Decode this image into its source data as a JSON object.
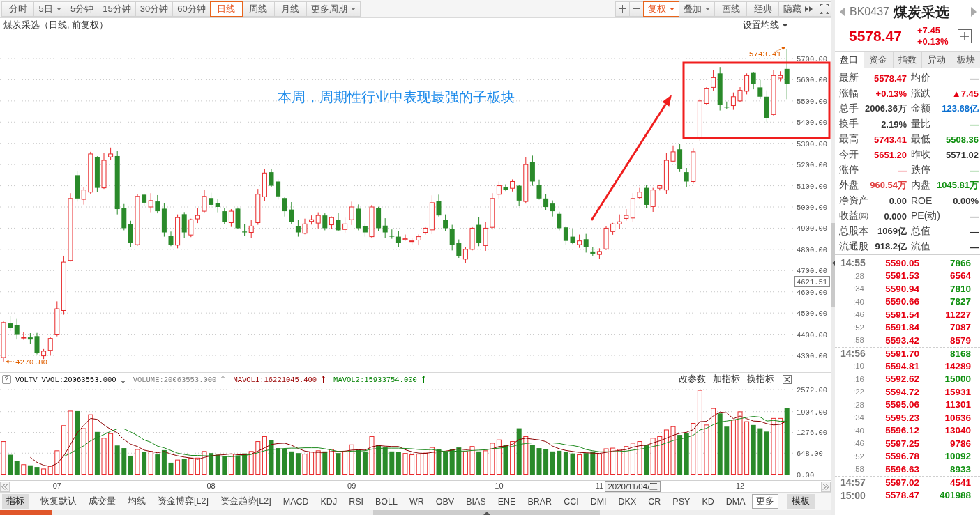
{
  "toolbar": {
    "periods": [
      {
        "label": "分时",
        "selected": false,
        "kind": "plain"
      },
      {
        "label": "5日",
        "selected": false,
        "kind": "dropdown"
      },
      {
        "label": "5分钟",
        "selected": false,
        "kind": "plain"
      },
      {
        "label": "15分钟",
        "selected": false,
        "kind": "plain"
      },
      {
        "label": "30分钟",
        "selected": false,
        "kind": "plain"
      },
      {
        "label": "60分钟",
        "selected": false,
        "kind": "plain"
      },
      {
        "label": "日线",
        "selected": true,
        "kind": "plain"
      },
      {
        "label": "周线",
        "selected": false,
        "kind": "plain"
      },
      {
        "label": "月线",
        "selected": false,
        "kind": "plain"
      },
      {
        "label": "更多周期",
        "selected": false,
        "kind": "dropdown"
      }
    ],
    "tools": [
      {
        "label": "复权",
        "selected": true,
        "kind": "dropdown"
      },
      {
        "label": "叠加",
        "selected": false,
        "kind": "dropdown"
      },
      {
        "label": "画线",
        "selected": false,
        "kind": "plain"
      },
      {
        "label": "经典",
        "selected": false,
        "kind": "plain"
      },
      {
        "label": "隐藏",
        "selected": false,
        "kind": "expand"
      }
    ]
  },
  "chart_header": {
    "title": "煤炭采选（日线, 前复权）",
    "ma_settings": "设置均线"
  },
  "price_chart": {
    "annotation": "本周，周期性行业中表现最强的子板块",
    "high_label": "5743.41",
    "low_label": "4270.80",
    "cursor_price": "4621.51",
    "axis_labels": [
      "5700.00",
      "5600.00",
      "5500.00",
      "5400.00",
      "5300.00",
      "5200.00",
      "5100.00",
      "5000.00",
      "4900.00",
      "4800.00",
      "4700.00",
      "4600.00",
      "4500.00",
      "4400.00",
      "4300.00"
    ]
  },
  "volume_panel": {
    "help": "?",
    "name": "VOLTV",
    "indicators": [
      {
        "text": "VVOL:20063553.000",
        "color": "#000000",
        "rising": false
      },
      {
        "text": "VOLUME:20063553.000",
        "color": "#808080",
        "rising": true
      },
      {
        "text": "MAVOL1:16221045.400",
        "color": "#990000",
        "rising": true
      },
      {
        "text": "MAVOL2:15933754.000",
        "color": "#008000",
        "rising": true
      }
    ],
    "actions": [
      "改参数",
      "加指标",
      "换指标"
    ],
    "chart_data": {
      "type": "bar",
      "ylim": [
        0,
        2572
      ],
      "grid": true,
      "yticks": [
        {
          "value": 0,
          "label": "0.00"
        },
        {
          "value": 648,
          "label": "648.00"
        },
        {
          "value": 1276,
          "label": "1276.00"
        },
        {
          "value": 1904,
          "label": "1904.00"
        },
        {
          "value": 2572,
          "label": "2572.00"
        }
      ],
      "series": [
        {
          "values": [
            1000,
            600,
            420,
            300,
            280,
            230,
            170,
            250,
            720,
            1480,
            1920,
            1920,
            1390,
            1810,
            1290,
            1100,
            1240,
            880,
            800,
            570,
            760,
            680,
            700,
            610,
            740,
            360,
            440,
            480,
            500,
            500,
            700,
            650,
            600,
            560,
            620,
            580,
            640,
            700,
            1000,
            1150,
            1050,
            800,
            760,
            700,
            650,
            620,
            680,
            720,
            700,
            760,
            650,
            700,
            900,
            750,
            700,
            1150,
            900,
            820,
            700,
            680,
            640,
            600,
            620,
            650,
            820,
            780,
            700,
            760,
            820,
            700,
            850,
            700,
            720,
            950,
            1050,
            900,
            1000,
            1400,
            1150,
            900,
            800,
            760,
            700,
            720,
            680,
            640,
            600,
            650,
            700,
            620,
            780,
            800,
            760,
            850,
            950,
            1000,
            900,
            1100,
            1150,
            1350,
            1450,
            1200,
            1250,
            1550,
            2550,
            1500,
            2000,
            1850,
            1450,
            1650,
            1900,
            1600,
            1500,
            1400,
            1300,
            1700,
            1700,
            2010
          ],
          "colors": [
            "#e8282a",
            "#2a8a2a",
            "#2a8a2a",
            "#e8282a",
            "#2a8a2a",
            "#2a8a2a",
            "#e8282a",
            "#e8282a",
            "#e8282a",
            "#e8282a",
            "#e8282a",
            "#2a8a2a",
            "#e8282a",
            "#e8282a",
            "#2a8a2a",
            "#e8282a",
            "#e8282a",
            "#2a8a2a",
            "#2a8a2a",
            "#2a8a2a",
            "#e8282a",
            "#2a8a2a",
            "#e8282a",
            "#2a8a2a",
            "#2a8a2a",
            "#2a8a2a",
            "#e8282a",
            "#2a8a2a",
            "#e8282a",
            "#e8282a",
            "#e8282a",
            "#2a8a2a",
            "#2a8a2a",
            "#2a8a2a",
            "#e8282a",
            "#2a8a2a",
            "#2a8a2a",
            "#e8282a",
            "#e8282a",
            "#e8282a",
            "#2a8a2a",
            "#2a8a2a",
            "#2a8a2a",
            "#2a8a2a",
            "#2a8a2a",
            "#e8282a",
            "#e8282a",
            "#e8282a",
            "#2a8a2a",
            "#e8282a",
            "#2a8a2a",
            "#e8282a",
            "#e8282a",
            "#2a8a2a",
            "#2a8a2a",
            "#e8282a",
            "#2a8a2a",
            "#2a8a2a",
            "#2a8a2a",
            "#2a8a2a",
            "#e8282a",
            "#e8282a",
            "#e8282a",
            "#e8282a",
            "#e8282a",
            "#2a8a2a",
            "#2a8a2a",
            "#2a8a2a",
            "#2a8a2a",
            "#e8282a",
            "#e8282a",
            "#2a8a2a",
            "#e8282a",
            "#e8282a",
            "#e8282a",
            "#2a8a2a",
            "#e8282a",
            "#2a8a2a",
            "#e8282a",
            "#2a8a2a",
            "#2a8a2a",
            "#2a8a2a",
            "#2a8a2a",
            "#2a8a2a",
            "#2a8a2a",
            "#2a8a2a",
            "#e8282a",
            "#2a8a2a",
            "#2a8a2a",
            "#e8282a",
            "#e8282a",
            "#e8282a",
            "#e8282a",
            "#e8282a",
            "#e8282a",
            "#e8282a",
            "#2a8a2a",
            "#e8282a",
            "#e8282a",
            "#e8282a",
            "#e8282a",
            "#2a8a2a",
            "#2a8a2a",
            "#e8282a",
            "#e8282a",
            "#e8282a",
            "#e8282a",
            "#2a8a2a",
            "#2a8a2a",
            "#e8282a",
            "#e8282a",
            "#e8282a",
            "#2a8a2a",
            "#2a8a2a",
            "#2a8a2a",
            "#e8282a",
            "#e8282a",
            "#2a8a2a"
          ]
        },
        {
          "type": "line",
          "color": "#8b0000",
          "values": [
            null,
            null,
            null,
            null,
            520,
            370,
            280,
            250,
            330,
            570,
            910,
            1260,
            1490,
            1700,
            1670,
            1500,
            1370,
            1260,
            1060,
            920,
            850,
            740,
            700,
            660,
            700,
            620,
            570,
            530,
            500,
            460,
            520,
            570,
            590,
            600,
            630,
            600,
            600,
            620,
            710,
            810,
            910,
            940,
            950,
            890,
            790,
            710,
            680,
            670,
            670,
            700,
            700,
            710,
            740,
            750,
            740,
            840,
            880,
            860,
            850,
            850,
            750,
            690,
            650,
            640,
            670,
            690,
            710,
            740,
            780,
            750,
            770,
            770,
            760,
            780,
            850,
            860,
            920,
            1060,
            1100,
            1070,
            1050,
            1000,
            860,
            780,
            730,
            700,
            670,
            660,
            650,
            640,
            670,
            710,
            730,
            760,
            830,
            870,
            890,
            960,
            1020,
            1100,
            1190,
            1250,
            1280,
            1360,
            1600,
            1610,
            1770,
            1890,
            1870,
            1690,
            1770,
            1690,
            1620,
            1610,
            1540,
            1500,
            1520,
            1620
          ]
        },
        {
          "type": "line",
          "color": "#1e8a1e",
          "values": [
            null,
            null,
            null,
            null,
            null,
            null,
            null,
            null,
            null,
            550,
            640,
            770,
            870,
            1020,
            1120,
            1210,
            1310,
            1380,
            1380,
            1290,
            1180,
            1050,
            980,
            860,
            810,
            730,
            650,
            610,
            580,
            580,
            570,
            570,
            560,
            550,
            540,
            560,
            580,
            610,
            660,
            720,
            760,
            770,
            790,
            800,
            800,
            810,
            810,
            810,
            780,
            740,
            700,
            690,
            710,
            710,
            720,
            770,
            790,
            800,
            800,
            800,
            790,
            780,
            760,
            750,
            760,
            720,
            700,
            700,
            710,
            710,
            730,
            740,
            750,
            780,
            800,
            820,
            850,
            910,
            940,
            960,
            960,
            960,
            960,
            940,
            900,
            880,
            840,
            760,
            720,
            690,
            690,
            690,
            700,
            710,
            740,
            770,
            800,
            850,
            890,
            960,
            1030,
            1070,
            1120,
            1190,
            1350,
            1400,
            1510,
            1590,
            1620,
            1650,
            1690,
            1730,
            1760,
            1740,
            1620,
            1640,
            1610,
            1620
          ]
        }
      ]
    }
  },
  "x_axis": {
    "months": [
      "07",
      "08",
      "09",
      "10",
      "11",
      "12"
    ],
    "cursor_date": "2020/11/04/三"
  },
  "indicator_bar": {
    "title": "指标",
    "tabs": [
      {
        "label": "恢复默认",
        "selected": false
      },
      {
        "label": "成交量",
        "selected": false
      },
      {
        "label": "均线",
        "selected": false
      },
      {
        "label": "资金博弈[L2]",
        "selected": false
      },
      {
        "label": "资金趋势[L2]",
        "selected": false
      },
      {
        "label": "MACD",
        "selected": false
      },
      {
        "label": "KDJ",
        "selected": false
      },
      {
        "label": "RSI",
        "selected": false
      },
      {
        "label": "BOLL",
        "selected": false
      },
      {
        "label": "WR",
        "selected": false
      },
      {
        "label": "OBV",
        "selected": false
      },
      {
        "label": "BIAS",
        "selected": false
      },
      {
        "label": "ENE",
        "selected": false
      },
      {
        "label": "BRAR",
        "selected": false
      },
      {
        "label": "CCI",
        "selected": false
      },
      {
        "label": "DMI",
        "selected": false
      },
      {
        "label": "DKX",
        "selected": false
      },
      {
        "label": "CR",
        "selected": false
      },
      {
        "label": "PSY",
        "selected": false
      },
      {
        "label": "KD",
        "selected": false
      },
      {
        "label": "DMA",
        "selected": false
      }
    ],
    "more": "更多",
    "template": "模板"
  },
  "quote_panel": {
    "code": "BK0437",
    "name": "煤炭采选",
    "price": "5578.47",
    "change": "+7.45",
    "change_pct": "+0.13%",
    "tabs": [
      {
        "label": "盘口",
        "selected": true
      },
      {
        "label": "资金",
        "selected": false
      },
      {
        "label": "指数",
        "selected": false
      },
      {
        "label": "异动",
        "selected": false
      },
      {
        "label": "板块",
        "selected": false
      }
    ],
    "rows": [
      {
        "left": {
          "label": "最新",
          "value": "5578.47",
          "color": "#e60012"
        },
        "right": {
          "label": "均价",
          "value": "—",
          "color": "#333333"
        }
      },
      {
        "left": {
          "label": "涨幅",
          "value": "+0.13%",
          "color": "#e60012"
        },
        "right": {
          "label": "涨跌",
          "value": "▲7.45",
          "color": "#e60012"
        }
      },
      {
        "left": {
          "label": "总手",
          "value": "2006.36万",
          "color": "#333333"
        },
        "right": {
          "label": "金额",
          "value": "123.68亿",
          "color": "#0a6fd0"
        }
      },
      {
        "left": {
          "label": "换手",
          "value": "2.19%",
          "color": "#333333"
        },
        "right": {
          "label": "量比",
          "value": "—",
          "color": "#109010"
        }
      },
      {
        "left": {
          "label": "最高",
          "value": "5743.41",
          "color": "#e60012"
        },
        "right": {
          "label": "最低",
          "value": "5508.36",
          "color": "#109010"
        }
      },
      {
        "left": {
          "label": "今开",
          "value": "5651.20",
          "color": "#e60012"
        },
        "right": {
          "label": "昨收",
          "value": "5571.02",
          "color": "#333333"
        }
      },
      {
        "left": {
          "label": "涨停",
          "value": "—",
          "color": "#e60012"
        },
        "right": {
          "label": "跌停",
          "value": "—",
          "color": "#109010"
        }
      },
      {
        "left": {
          "label": "外盘",
          "value": "960.54万",
          "color": "#e03c3c"
        },
        "right": {
          "label": "内盘",
          "value": "1045.81万",
          "color": "#109010"
        }
      },
      {
        "left": {
          "label": "净资产",
          "value": "0.00",
          "color": "#333333"
        },
        "right": {
          "label": "ROE",
          "value": "0.00%",
          "color": "#333333"
        }
      },
      {
        "left": {
          "label": "收益㈣",
          "value": "0.000",
          "color": "#333333"
        },
        "right": {
          "label": "PE(动)",
          "value": "—",
          "color": "#333333"
        }
      },
      {
        "left": {
          "label": "总股本",
          "value": "1069亿",
          "color": "#333333"
        },
        "right": {
          "label": "总值",
          "value": "—",
          "color": "#333333"
        }
      },
      {
        "left": {
          "label": "流通股",
          "value": "918.2亿",
          "color": "#333333"
        },
        "right": {
          "label": "流值",
          "value": "—",
          "color": "#333333"
        }
      }
    ],
    "ticks": [
      {
        "time": "14:55",
        "kind": "minute",
        "price": "5590.05",
        "volume": "7866",
        "color": "#109010"
      },
      {
        "time": ":28",
        "kind": "second",
        "price": "5591.53",
        "volume": "6564",
        "color": "#e60012"
      },
      {
        "time": ":34",
        "kind": "second",
        "price": "5590.94",
        "volume": "7810",
        "color": "#109010"
      },
      {
        "time": ":40",
        "kind": "second",
        "price": "5590.66",
        "volume": "7827",
        "color": "#109010"
      },
      {
        "time": ":46",
        "kind": "second",
        "price": "5591.54",
        "volume": "11227",
        "color": "#e60012"
      },
      {
        "time": ":52",
        "kind": "second",
        "price": "5591.84",
        "volume": "7087",
        "color": "#e60012"
      },
      {
        "time": ":58",
        "kind": "second",
        "price": "5593.42",
        "volume": "8579",
        "color": "#e60012"
      },
      {
        "time": "14:56",
        "kind": "minute",
        "price": "5591.70",
        "volume": "8168",
        "color": "#109010"
      },
      {
        "time": ":10",
        "kind": "second",
        "price": "5594.81",
        "volume": "14289",
        "color": "#e60012"
      },
      {
        "time": ":16",
        "kind": "second",
        "price": "5592.62",
        "volume": "15000",
        "color": "#109010"
      },
      {
        "time": ":22",
        "kind": "second",
        "price": "5594.72",
        "volume": "15931",
        "color": "#e60012"
      },
      {
        "time": ":28",
        "kind": "second",
        "price": "5595.06",
        "volume": "11301",
        "color": "#e60012"
      },
      {
        "time": ":34",
        "kind": "second",
        "price": "5595.23",
        "volume": "10636",
        "color": "#e60012"
      },
      {
        "time": ":40",
        "kind": "second",
        "price": "5596.12",
        "volume": "13040",
        "color": "#e60012"
      },
      {
        "time": ":46",
        "kind": "second",
        "price": "5597.25",
        "volume": "9786",
        "color": "#e60012"
      },
      {
        "time": ":52",
        "kind": "second",
        "price": "5596.78",
        "volume": "10092",
        "color": "#109010"
      },
      {
        "time": ":58",
        "kind": "second",
        "price": "5596.63",
        "volume": "8933",
        "color": "#109010"
      },
      {
        "time": "14:57",
        "kind": "minute",
        "price": "5597.02",
        "volume": "4541",
        "color": "#e60012"
      },
      {
        "time": "15:00",
        "kind": "minute",
        "price": "5578.47",
        "volume": "401988",
        "color": "#109010"
      }
    ]
  }
}
